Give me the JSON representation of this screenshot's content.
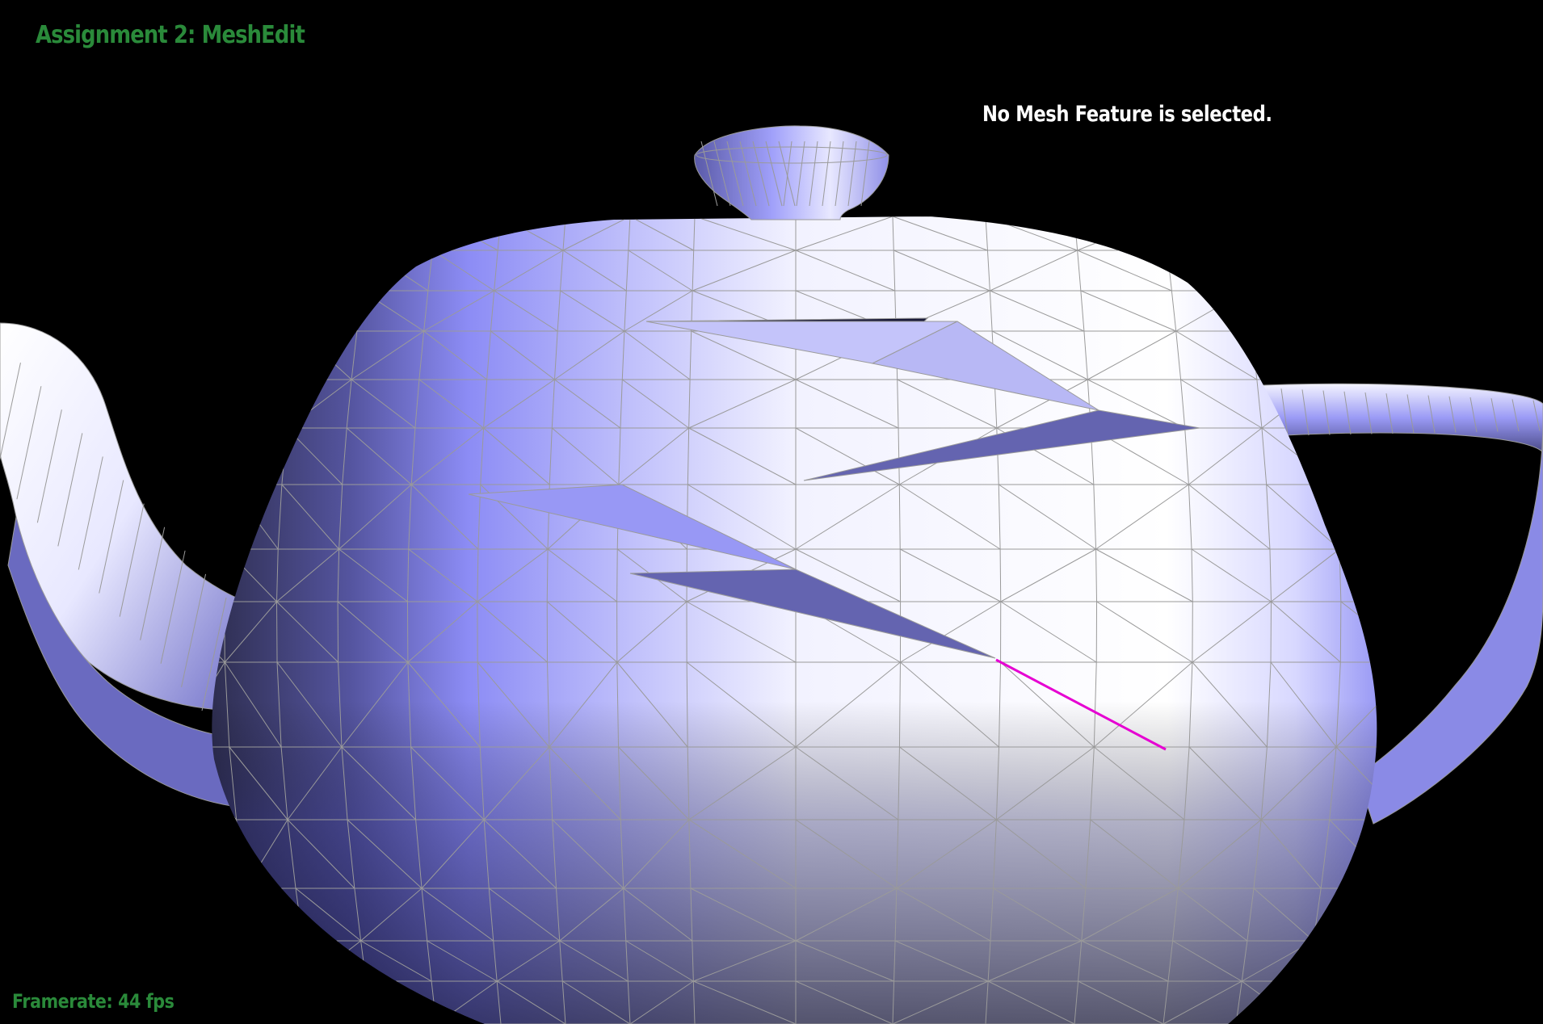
{
  "app": {
    "title": "Assignment 2: MeshEdit",
    "status_message": "No Mesh Feature is selected.",
    "framerate_text": "Framerate: 44 fps"
  },
  "colors": {
    "background": "#000000",
    "hud_title": "#2a8a3a",
    "hud_status": "#ffffff",
    "hud_fps": "#2a8a3a",
    "mesh_light": "#ffffff",
    "mesh_base": "#8c8cff",
    "mesh_dark": "#3a3a66",
    "wireframe": "#9a9a9a",
    "highlighted_edge": "#e600d2"
  },
  "scene": {
    "object": "teapot",
    "render_mode": "wireframe-shaded",
    "highlighted_element": "edge"
  }
}
